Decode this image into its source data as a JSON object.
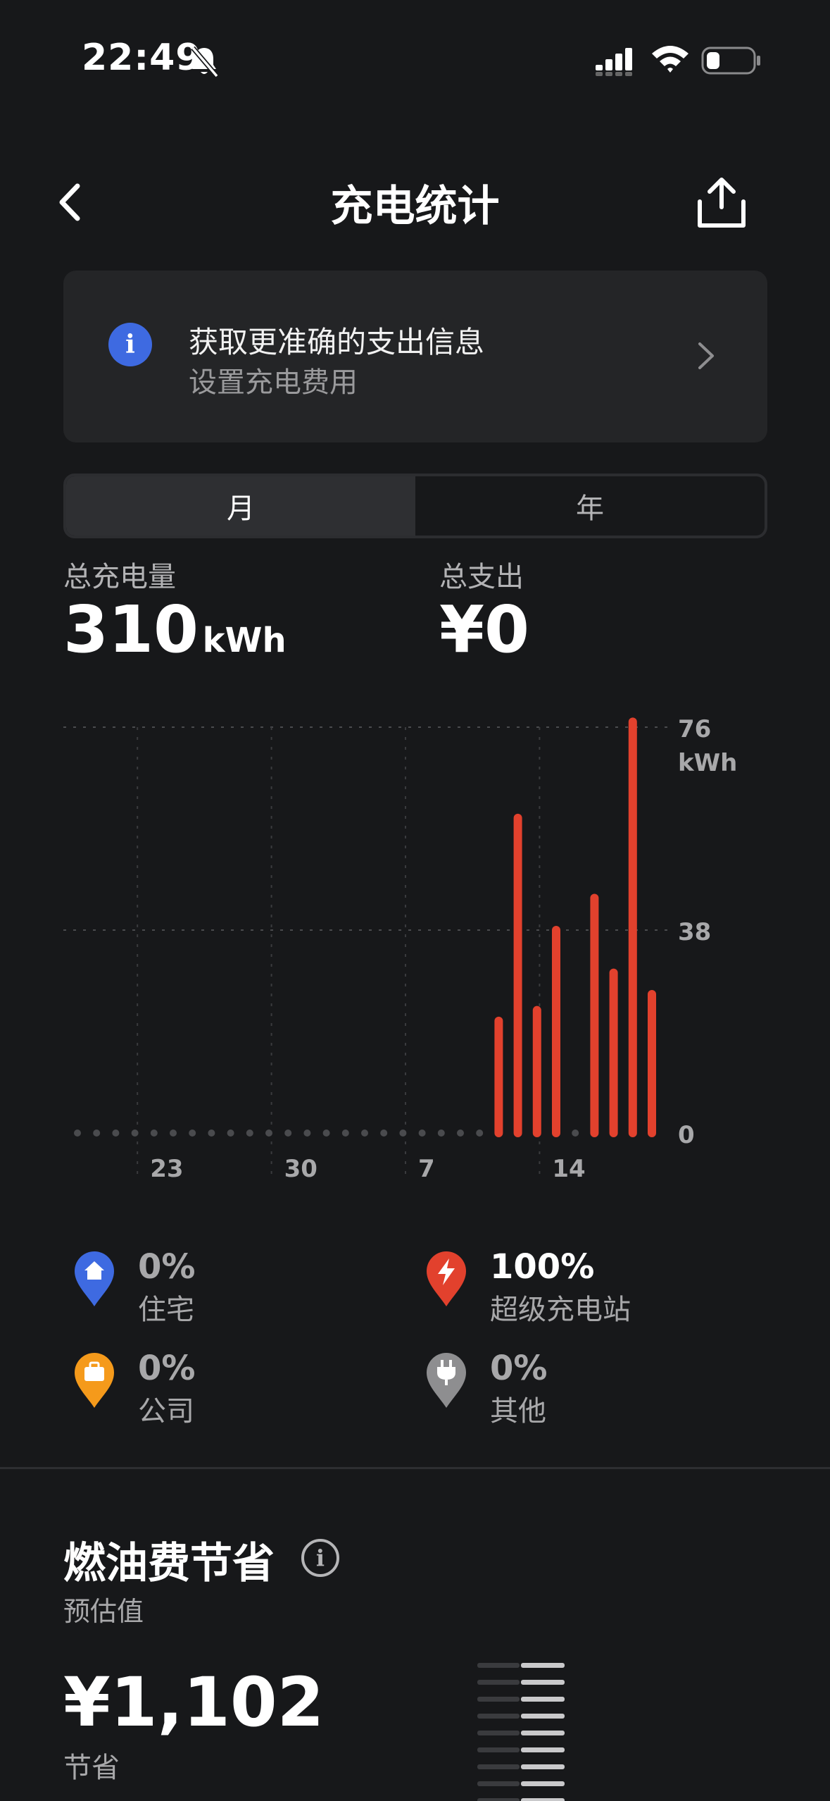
{
  "status_bar": {
    "time": "22:49"
  },
  "header": {
    "title": "充电统计"
  },
  "info_card": {
    "icon": "i",
    "title": "获取更准确的支出信息",
    "subtitle": "设置充电费用"
  },
  "tabs": [
    {
      "label": "月",
      "active": true
    },
    {
      "label": "年",
      "active": false
    }
  ],
  "totals": {
    "energy_label": "总充电量",
    "energy_value": "310",
    "energy_unit": "kWh",
    "cost_label": "总支出",
    "cost_value": "¥0"
  },
  "chart_data": {
    "type": "bar",
    "unit": "kWh",
    "y_ticks": [
      "76",
      "38",
      "0"
    ],
    "y_unit_label": "kWh",
    "ylim": [
      0,
      76
    ],
    "x_ticks": [
      "23",
      "30",
      "7",
      "14"
    ],
    "bar_color": "#e2412d",
    "day_slots": 31,
    "bars": [
      {
        "slot": 22,
        "value": 21
      },
      {
        "slot": 23,
        "value": 59
      },
      {
        "slot": 24,
        "value": 23
      },
      {
        "slot": 25,
        "value": 38
      },
      {
        "slot": 27,
        "value": 44
      },
      {
        "slot": 28,
        "value": 30
      },
      {
        "slot": 29,
        "value": 77
      },
      {
        "slot": 30,
        "value": 26
      }
    ]
  },
  "legend": [
    {
      "icon": "home-icon",
      "color": "#3e6ae1",
      "percent": "0%",
      "label": "住宅"
    },
    {
      "icon": "bolt-icon",
      "color": "#e2412d",
      "percent": "100%",
      "label": "超级充电站"
    },
    {
      "icon": "briefcase-icon",
      "color": "#f59a1b",
      "percent": "0%",
      "label": "公司"
    },
    {
      "icon": "plug-icon",
      "color": "#8e8e90",
      "percent": "0%",
      "label": "其他"
    }
  ],
  "fuel_savings": {
    "title": "燃油费节省",
    "info_icon": "i",
    "subtitle": "预估值",
    "value": "¥1,102",
    "value_label": "节省"
  }
}
